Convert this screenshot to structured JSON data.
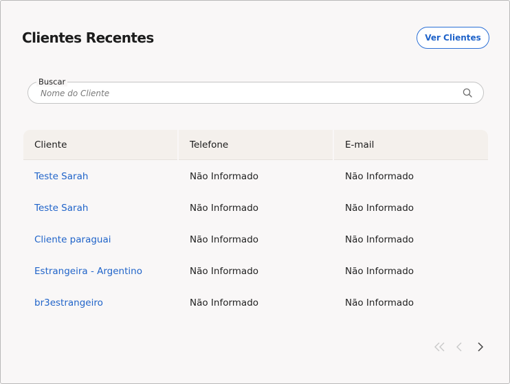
{
  "header": {
    "title": "Clientes Recentes",
    "view_button_label": "Ver Clientes"
  },
  "search": {
    "label": "Buscar",
    "placeholder": "Nome do Cliente",
    "value": ""
  },
  "table": {
    "columns": [
      "Cliente",
      "Telefone",
      "E-mail"
    ],
    "rows": [
      {
        "cliente": "Teste Sarah",
        "telefone": "Não Informado",
        "email": "Não Informado"
      },
      {
        "cliente": "Teste Sarah",
        "telefone": "Não Informado",
        "email": "Não Informado"
      },
      {
        "cliente": "Cliente paraguai",
        "telefone": "Não Informado",
        "email": "Não Informado"
      },
      {
        "cliente": "Estrangeira - Argentino",
        "telefone": "Não Informado",
        "email": "Não Informado"
      },
      {
        "cliente": "br3estrangeiro",
        "telefone": "Não Informado",
        "email": "Não Informado"
      }
    ]
  },
  "pagination": {
    "icons": [
      "double-chevron-left-icon",
      "chevron-left-icon",
      "chevron-right-icon"
    ],
    "first_enabled": false,
    "prev_enabled": false,
    "next_enabled": true
  },
  "colors": {
    "accent": "#1f63c9",
    "card_background": "#f9f7f7",
    "header_background": "#f4f0ec",
    "disabled_icon": "#c8c8c8",
    "enabled_icon": "#444444"
  }
}
